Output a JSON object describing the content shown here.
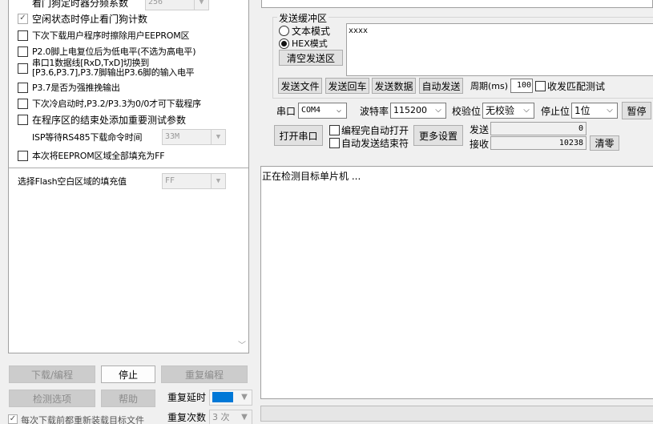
{
  "left_panel": {
    "options": [
      {
        "text": "看门狗定时器分频系数",
        "checked": false,
        "select": "256",
        "cut": true
      },
      {
        "text": "空闲状态时停止看门狗计数",
        "checked": true
      },
      {
        "text": "下次下载用户程序时擦除用户EEPROM区",
        "checked": false
      },
      {
        "text": "P2.0脚上电复位后为低电平(不选为高电平)",
        "checked": false
      },
      {
        "text1": "串口1数据线[RxD,TxD]切换到",
        "text2": "[P3.6,P3.7],P3.7脚输出P3.6脚的输入电平",
        "checked": false
      },
      {
        "text": "P3.7是否为强推挽输出",
        "checked": false
      },
      {
        "text": "下次冷启动时,P3.2/P3.3为0/0才可下载程序",
        "checked": false
      },
      {
        "text": "在程序区的结束处添加重要测试参数",
        "checked": false
      },
      {
        "text": "ISP等待RS485下载命令时间",
        "select": "33M"
      },
      {
        "text": "本次将EEPROM区域全部填充为FF",
        "checked": false
      }
    ],
    "flash_fill_label": "选择Flash空白区域的填充值",
    "flash_fill_value": "FF"
  },
  "left_buttons": {
    "download": "下载/编程",
    "stop": "停止",
    "reprogram": "重复编程",
    "detect": "检测选项",
    "help": "帮助",
    "repeat_delay_label": "重复延时",
    "repeat_delay_value": "1 秒",
    "repeat_count_label": "重复次数",
    "repeat_count_value": "3 次",
    "reload_label": "每次下载前都重新装载目标文件"
  },
  "send": {
    "group_label": "发送缓冲区",
    "text_mode": "文本模式",
    "hex_mode": "HEX模式",
    "mode_selected": "hex",
    "clear_btn": "清空发送区",
    "buffer": "xxxx",
    "send_file": "发送文件",
    "send_echo": "发送回车",
    "send_data": "发送数据",
    "auto_send": "自动发送",
    "period_label": "周期(ms)",
    "period_value": "100",
    "match_test": "收发匹配测试"
  },
  "serial": {
    "port_label": "串口",
    "port_value": "COM4",
    "baud_label": "波特率",
    "baud_value": "115200",
    "parity_label": "校验位",
    "parity_value": "无校验",
    "stop_label": "停止位",
    "stop_value": "1位",
    "pause_btn": "暂停",
    "open_btn": "打开串口",
    "auto_open": "编程完自动打开",
    "auto_send_end": "自动发送结束符",
    "more_settings": "更多设置",
    "tx_label": "发送",
    "tx_count": "0",
    "rx_label": "接收",
    "rx_count": "10238",
    "clear_btn": "清零"
  },
  "receive": {
    "status_text": "正在检测目标单片机 ..."
  },
  "colors": {
    "panel_bg": "#f0f0f0",
    "highlight": "#0078d7"
  }
}
